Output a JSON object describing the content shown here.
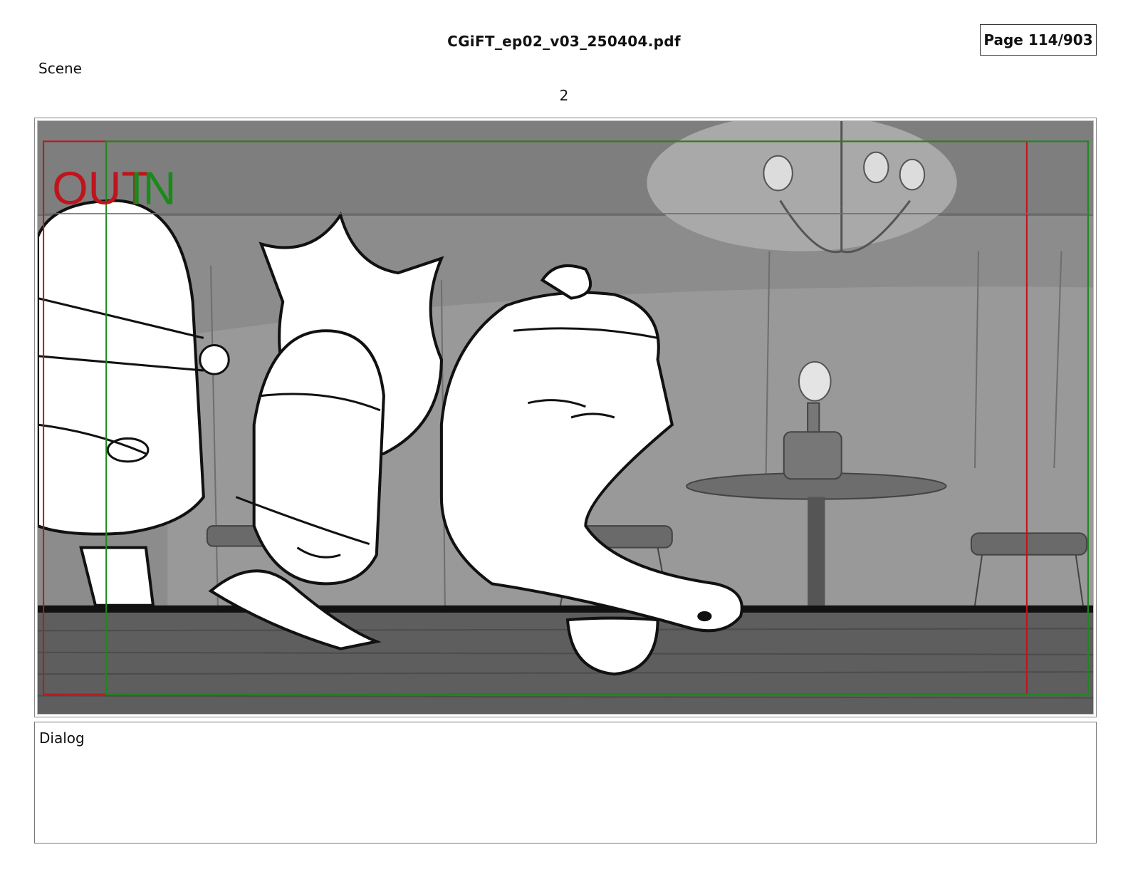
{
  "document": {
    "filename": "CGiFT_ep02_v03_250404.pdf",
    "page_label": "Page 114/903"
  },
  "scene": {
    "label": "Scene",
    "number": "2"
  },
  "panel": {
    "out_marker": "OUT",
    "in_marker": "IN",
    "colors": {
      "out_frame": "#c0141c",
      "in_frame": "#1a8a1a",
      "bar_wood": "#5e5e5e",
      "wall": "#8c8c8c"
    }
  },
  "dialog": {
    "label": "Dialog",
    "text": ""
  }
}
